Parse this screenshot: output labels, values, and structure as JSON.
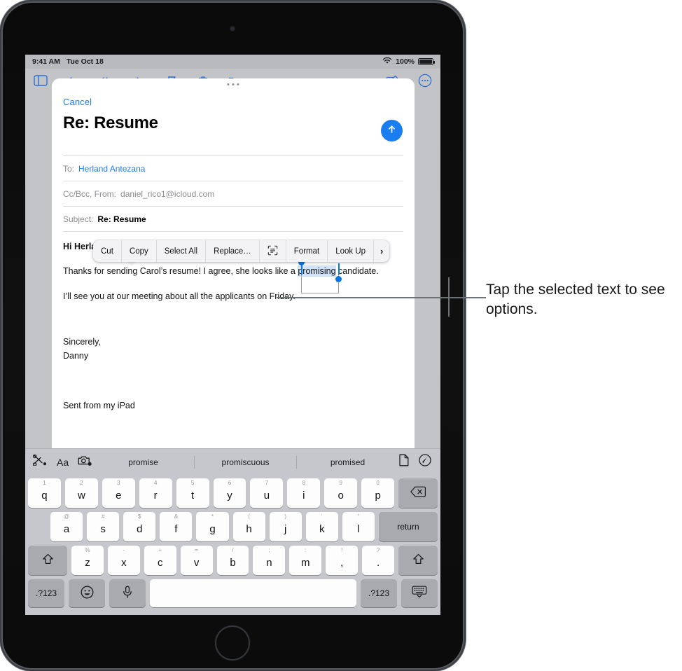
{
  "status_bar": {
    "time": "9:41 AM",
    "date": "Tue Oct 18",
    "battery_percent": "100%",
    "wifi_icon": "wifi-icon",
    "battery_icon": "battery-icon"
  },
  "mail_toolbar": {
    "icons": [
      "sidebar-icon",
      "reply-icon",
      "reply-all-icon",
      "forward-icon",
      "flag-icon",
      "move-icon",
      "trash-icon",
      "folder-icon",
      "compose-icon",
      "more-icon"
    ]
  },
  "compose": {
    "cancel_label": "Cancel",
    "title": "Re: Resume",
    "send_icon": "send-arrow-up-icon",
    "to_label": "To:",
    "to_value": "Herland Antezana",
    "cc_label": "Cc/Bcc, From:",
    "cc_value": "daniel_rico1@icloud.com",
    "subject_label": "Subject:",
    "subject_value": "Re: Resume",
    "body": {
      "greeting": "Hi Herland,",
      "line1_before": "Thanks for sending Carol’s resume! I agree, she looks like a ",
      "line1_selected": "promising",
      "line1_after": " candidate.",
      "line2": "I’ll see you at our meeting about all the applicants on Friday.",
      "signoff": "Sincerely,",
      "signature": "Danny",
      "sent_from": "Sent from my iPad"
    }
  },
  "context_menu": {
    "items": [
      {
        "label": "Cut",
        "icon": null
      },
      {
        "label": "Copy",
        "icon": null
      },
      {
        "label": "Select All",
        "icon": null
      },
      {
        "label": "Replace…",
        "icon": null
      },
      {
        "label": "",
        "icon": "scan-text-icon"
      },
      {
        "label": "Format",
        "icon": null
      },
      {
        "label": "Look Up",
        "icon": null
      },
      {
        "label": "›",
        "icon": "chevron-right-icon"
      }
    ]
  },
  "predictive_bar": {
    "left_icons": [
      "scissors-icon",
      "text-format-aa-icon",
      "camera-icon"
    ],
    "suggestions": [
      "promise",
      "promiscuous",
      "promised"
    ],
    "right_icons": [
      "document-icon",
      "markup-pen-icon"
    ]
  },
  "keyboard": {
    "row1": [
      {
        "main": "q",
        "sec": "1"
      },
      {
        "main": "w",
        "sec": "2"
      },
      {
        "main": "e",
        "sec": "3"
      },
      {
        "main": "r",
        "sec": "4"
      },
      {
        "main": "t",
        "sec": "5"
      },
      {
        "main": "y",
        "sec": "6"
      },
      {
        "main": "u",
        "sec": "7"
      },
      {
        "main": "i",
        "sec": "8"
      },
      {
        "main": "o",
        "sec": "9"
      },
      {
        "main": "p",
        "sec": "0"
      }
    ],
    "backspace_icon": "backspace-icon",
    "row2": [
      {
        "main": "a",
        "sec": "@"
      },
      {
        "main": "s",
        "sec": "#"
      },
      {
        "main": "d",
        "sec": "$"
      },
      {
        "main": "f",
        "sec": "&"
      },
      {
        "main": "g",
        "sec": "*"
      },
      {
        "main": "h",
        "sec": "("
      },
      {
        "main": "j",
        "sec": ")"
      },
      {
        "main": "k",
        "sec": "’"
      },
      {
        "main": "l",
        "sec": "”"
      }
    ],
    "return_label": "return",
    "row3": [
      {
        "main": "z",
        "sec": "%"
      },
      {
        "main": "x",
        "sec": "-"
      },
      {
        "main": "c",
        "sec": "+"
      },
      {
        "main": "v",
        "sec": "="
      },
      {
        "main": "b",
        "sec": "/"
      },
      {
        "main": "n",
        "sec": ";"
      },
      {
        "main": "m",
        "sec": ":"
      },
      {
        "main": ",",
        "sec": "!"
      },
      {
        "main": ".",
        "sec": "?"
      }
    ],
    "shift_icon": "shift-icon",
    "row4": {
      "num_left": ".?123",
      "emoji_icon": "emoji-icon",
      "mic_icon": "microphone-icon",
      "space_label": "",
      "num_right": ".?123",
      "dismiss_icon": "hide-keyboard-icon"
    }
  },
  "callout": {
    "text": "Tap the selected text to see options."
  },
  "colors": {
    "accent_blue": "#1b7ef0",
    "selection_blue": "#cfe2f7",
    "handle_blue": "#0b74e5",
    "keyboard_bg": "#c6c7cc",
    "key_light": "#fdfdfd",
    "key_dark": "#a8aab0"
  }
}
